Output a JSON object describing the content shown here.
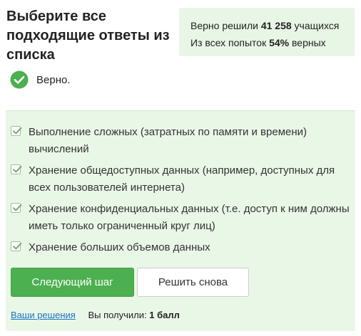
{
  "question": {
    "title": "Выберите все подходящие ответы из списка"
  },
  "stats": {
    "line1_prefix": "Верно решили ",
    "solved_count": "41 258",
    "line1_suffix": " учащихся",
    "line2_prefix": "Из всех попыток ",
    "correct_percent": "54%",
    "line2_suffix": " верных"
  },
  "result": {
    "status_icon": "check-circle-icon",
    "status_text": "Верно."
  },
  "options": [
    {
      "text": "Выполнение сложных (затратных по памяти и времени) вычислений",
      "checked": true
    },
    {
      "text": "Хранение общедоступных данных (например, доступных для всех пользователей интернета)",
      "checked": true
    },
    {
      "text": "Хранение конфиденциальных данных (т.е. доступ к ним должны иметь только ограниченный круг лиц)",
      "checked": true
    },
    {
      "text": "Хранение больших объемов данных",
      "checked": true
    }
  ],
  "actions": {
    "next_step_label": "Следующий шаг",
    "retry_label": "Решить снова"
  },
  "footer": {
    "solutions_link": "Ваши решения",
    "score_prefix": "Вы получили: ",
    "score_value": "1 балл"
  },
  "colors": {
    "accent_green": "#4caf50",
    "panel_bg": "#e9f7e7",
    "link_blue": "#1a73c4"
  }
}
